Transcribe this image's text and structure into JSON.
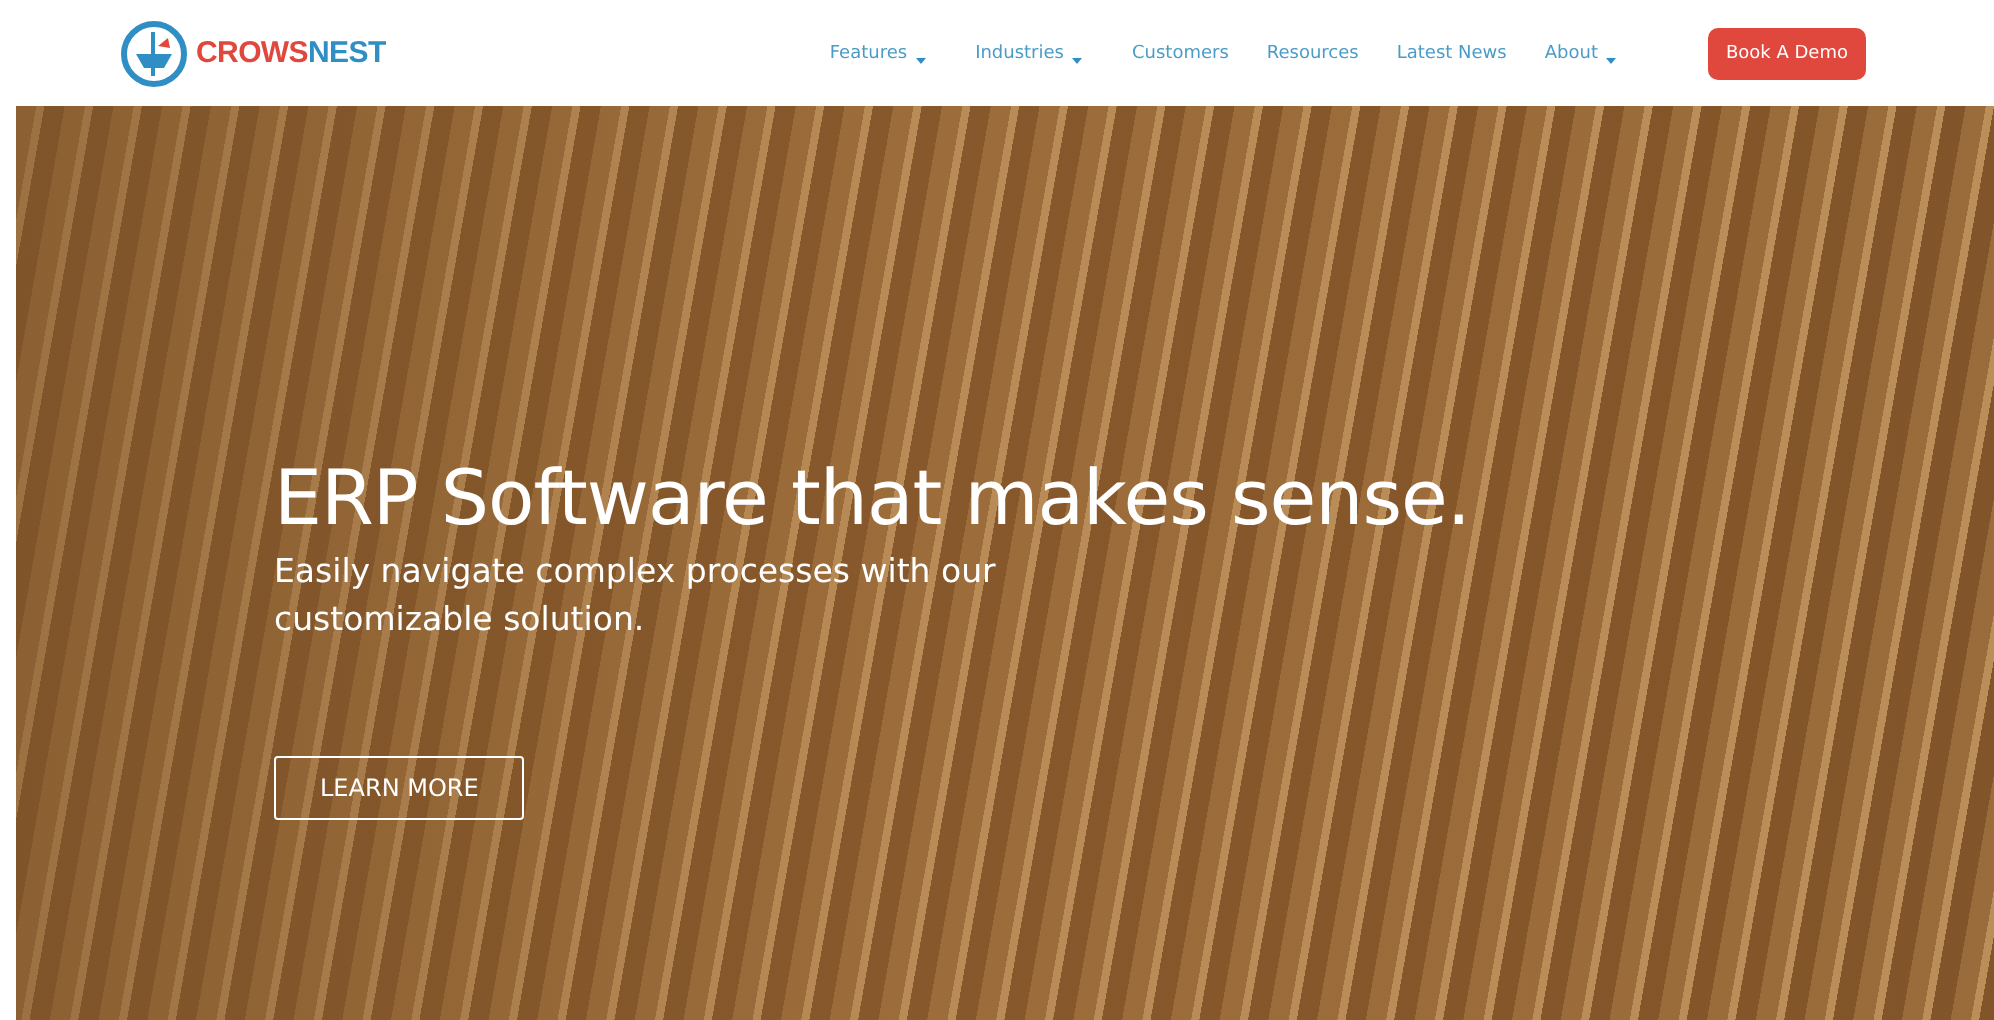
{
  "logo": {
    "name_first": "CROWS",
    "name_second": "NEST"
  },
  "nav": [
    {
      "label": "Features",
      "has_dropdown": true
    },
    {
      "label": "Industries",
      "has_dropdown": true
    },
    {
      "label": "Customers",
      "has_dropdown": false
    },
    {
      "label": "Resources",
      "has_dropdown": false
    },
    {
      "label": "Latest News",
      "has_dropdown": false
    },
    {
      "label": "About",
      "has_dropdown": true
    }
  ],
  "cta": {
    "label": "Book A Demo"
  },
  "hero": {
    "title": "ERP Software that makes sense.",
    "subtitle": "Easily navigate complex processes with our customizable solution.",
    "button": "LEARN MORE"
  }
}
